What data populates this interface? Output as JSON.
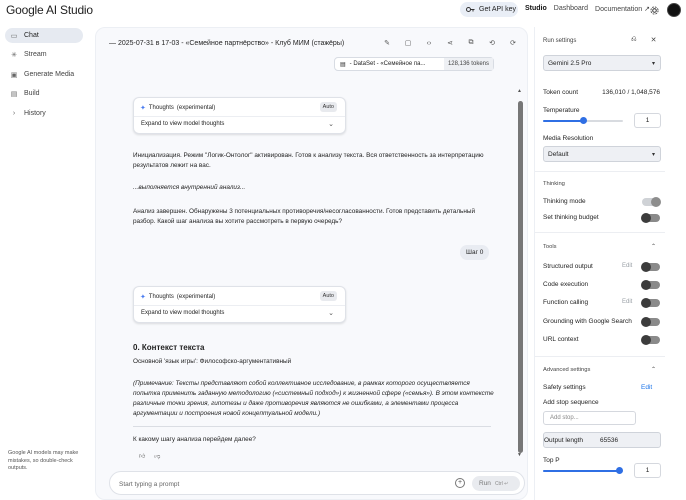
{
  "app": {
    "logo": "Google AI Studio",
    "get_api_key": "Get API key",
    "nav": [
      "Studio",
      "Dashboard",
      "Documentation"
    ]
  },
  "sidebar": {
    "items": [
      {
        "label": "Chat",
        "icon": "chat-icon",
        "active": true
      },
      {
        "label": "Stream",
        "icon": "stream-icon"
      },
      {
        "label": "Generate Media",
        "icon": "media-icon"
      },
      {
        "label": "Build",
        "icon": "build-icon"
      },
      {
        "label": "History",
        "icon": "history-icon"
      }
    ],
    "disclaimer": "Google AI models may make mistakes, so double-check outputs."
  },
  "chat": {
    "title": "— 2025-07-31 в 17-03 - «Семейное партнёрство» - Клуб МИМ (стажёры)",
    "dataset": {
      "name": "- DataSet - «Семейное па...",
      "tokens": "128,136 tokens"
    },
    "thoughts_label": "Thoughts",
    "thoughts_tag": "(experimental)",
    "thoughts_auto": "Auto",
    "thoughts_expand": "Expand to view model thoughts",
    "messages": {
      "m1": "Инициализация. Режим \"Логик-Онтолог\" активирован. Готов к анализу текста. Вся ответственность за интерпретацию результатов лежит на вас.",
      "m2": "...выполняется внутренний анализ...",
      "m3": "Анализ завершен. Обнаружены 3 потенциальных противоречия/несогласованности. Готов представить детальный разбор. Какой шаг анализа вы хотите рассмотреть в первую очередь?",
      "user": "Шаг 0",
      "heading": "0. Контекст текста",
      "m4": "Основной 'язык игры': Философско-аргументативный",
      "m5": "(Примечание: Тексты представляют собой коллективное исследование, в рамках которого осуществляется попытка применить заданную методологию («системный подход») к жизненной сфере («семья»). В этом контексте различные точки зрения, гипотезы и даже противоречия являются не ошибками, а элементами процесса аргументации и построения новой концептуальной модели.)",
      "m6": "К какому шагу анализа перейдем далее?"
    },
    "prompt_placeholder": "Start typing a prompt",
    "run_label": "Run",
    "run_shortcut": "Ctrl ↵"
  },
  "settings": {
    "title": "Run settings",
    "model": "Gemini 2.5 Pro",
    "token_count_label": "Token count",
    "token_count_value": "136,010 / 1,048,576",
    "temperature_label": "Temperature",
    "temperature_value": "1",
    "temperature_fraction": 0.5,
    "media_resolution_label": "Media Resolution",
    "media_resolution_value": "Default",
    "thinking_section": "Thinking",
    "thinking_mode": "Thinking mode",
    "thinking_mode_on": true,
    "thinking_budget": "Set thinking budget",
    "tools_section": "Tools",
    "structured_output": "Structured output",
    "code_execution": "Code execution",
    "function_calling": "Function calling",
    "grounding": "Grounding with Google Search",
    "url_context": "URL context",
    "edit": "Edit",
    "advanced_section": "Advanced settings",
    "safety_settings": "Safety settings",
    "add_stop_sequence": "Add stop sequence",
    "add_stop_placeholder": "Add stop...",
    "output_length_label": "Output length",
    "output_length_value": "65536",
    "top_p_label": "Top P",
    "top_p_value": "1",
    "top_p_fraction": 0.95
  }
}
